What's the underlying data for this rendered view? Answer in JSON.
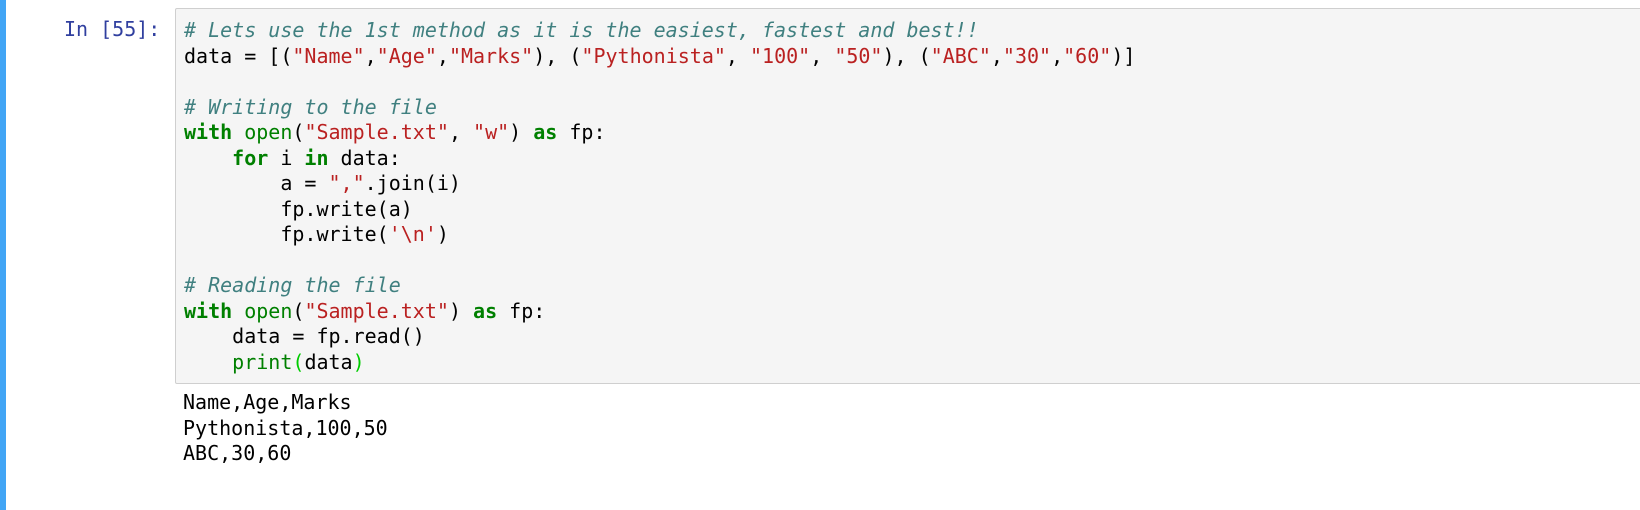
{
  "cell": {
    "prompt": "In [55]:",
    "code": [
      [
        {
          "t": "# Lets use the 1st method as it is the easiest, fastest and best!!",
          "c": "c"
        }
      ],
      [
        {
          "t": "data = [("
        },
        {
          "t": "\"Name\"",
          "c": "s"
        },
        {
          "t": ","
        },
        {
          "t": "\"Age\"",
          "c": "s"
        },
        {
          "t": ","
        },
        {
          "t": "\"Marks\"",
          "c": "s"
        },
        {
          "t": "), ("
        },
        {
          "t": "\"Pythonista\"",
          "c": "s"
        },
        {
          "t": ", "
        },
        {
          "t": "\"100\"",
          "c": "s"
        },
        {
          "t": ", "
        },
        {
          "t": "\"50\"",
          "c": "s"
        },
        {
          "t": "), ("
        },
        {
          "t": "\"ABC\"",
          "c": "s"
        },
        {
          "t": ","
        },
        {
          "t": "\"30\"",
          "c": "s"
        },
        {
          "t": ","
        },
        {
          "t": "\"60\"",
          "c": "s"
        },
        {
          "t": ")]"
        }
      ],
      [],
      [
        {
          "t": "# Writing to the file",
          "c": "c"
        }
      ],
      [
        {
          "t": "with",
          "c": "k"
        },
        {
          "t": " "
        },
        {
          "t": "open",
          "c": "b"
        },
        {
          "t": "("
        },
        {
          "t": "\"Sample.txt\"",
          "c": "s"
        },
        {
          "t": ", "
        },
        {
          "t": "\"w\"",
          "c": "s"
        },
        {
          "t": ") "
        },
        {
          "t": "as",
          "c": "k"
        },
        {
          "t": " fp:"
        }
      ],
      [
        {
          "t": "    "
        },
        {
          "t": "for",
          "c": "k"
        },
        {
          "t": " i "
        },
        {
          "t": "in",
          "c": "k"
        },
        {
          "t": " data:"
        }
      ],
      [
        {
          "t": "        a = "
        },
        {
          "t": "\",\"",
          "c": "s"
        },
        {
          "t": ".join(i)"
        }
      ],
      [
        {
          "t": "        fp.write(a)"
        }
      ],
      [
        {
          "t": "        fp.write("
        },
        {
          "t": "'\\n'",
          "c": "s"
        },
        {
          "t": ")"
        }
      ],
      [],
      [
        {
          "t": "# Reading the file",
          "c": "c"
        }
      ],
      [
        {
          "t": "with",
          "c": "k"
        },
        {
          "t": " "
        },
        {
          "t": "open",
          "c": "b"
        },
        {
          "t": "("
        },
        {
          "t": "\"Sample.txt\"",
          "c": "s"
        },
        {
          "t": ") "
        },
        {
          "t": "as",
          "c": "k"
        },
        {
          "t": " fp:"
        }
      ],
      [
        {
          "t": "    data = fp.read()"
        }
      ],
      [
        {
          "t": "    "
        },
        {
          "t": "print",
          "c": "b"
        },
        {
          "t": "(",
          "c": "p"
        },
        {
          "t": "data"
        },
        {
          "t": ")",
          "c": "p"
        }
      ]
    ],
    "output": [
      "Name,Age,Marks",
      "Pythonista,100,50",
      "ABC,30,60"
    ]
  },
  "colors": {
    "cell_bar": "#42a5f5",
    "prompt": "#303f9f",
    "comment": "#408080",
    "string": "#ba2121",
    "keyword": "#008000",
    "builtin": "#008000",
    "matched_paren": "#00cc00",
    "input_background": "#f5f5f5",
    "input_border": "#cfcfcf"
  }
}
